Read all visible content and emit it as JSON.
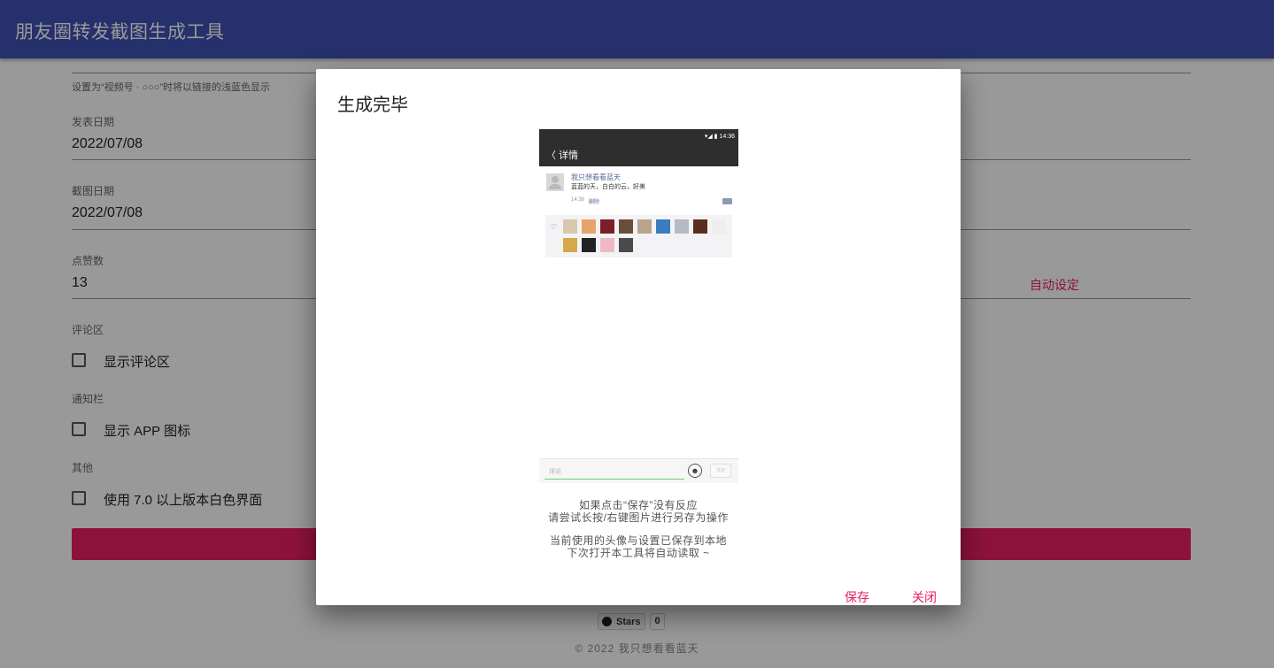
{
  "app": {
    "title": "朋友圈转发截图生成工具"
  },
  "form": {
    "hint": "设置为“视频号 · ○○○”时将以链接的浅蓝色显示",
    "publish_date": {
      "label": "发表日期",
      "value": "2022/07/08"
    },
    "screenshot_date": {
      "label": "截图日期",
      "value": "2022/07/08"
    },
    "likes": {
      "label": "点赞数",
      "value": "13",
      "auto_label": "自动设定"
    },
    "comment_section": {
      "label": "评论区",
      "checkbox": "显示评论区",
      "checked": false
    },
    "notification_bar": {
      "label": "通知栏",
      "checkbox": "显示 APP 图标",
      "checked": false
    },
    "other": {
      "label": "其他",
      "checkbox": "使用 7.0 以上版本白色界面",
      "checked": false
    }
  },
  "github": {
    "stars_label": "Stars",
    "stars_count": "0"
  },
  "footer": {
    "text": "© 2022 我只想看看蓝天"
  },
  "dialog": {
    "title": "生成完毕",
    "preview": {
      "status": "▾◢ ▮ 14:36",
      "header": "〈  详情",
      "author": "我只想看看蓝天",
      "text": "蓝蓝的天，白白的云，好美",
      "time": "14:36",
      "delete": "删除",
      "comment_placeholder": "评论",
      "send": "发送",
      "like_colors": [
        "#d9c7b0",
        "#e8a36b",
        "#7a1f2a",
        "#6a4e3a",
        "#b9a48d",
        "#3b7bbf",
        "#b5b9c7",
        "#5a2e1e",
        "#eeeeee",
        "#d4a94a",
        "#222222",
        "#f0b8c4",
        "#4a4a4a"
      ]
    },
    "note1_line1": "如果点击“保存”没有反应",
    "note1_line2": "请尝试长按/右键图片进行另存为操作",
    "note2_line1": "当前使用的头像与设置已保存到本地",
    "note2_line2": "下次打开本工具将自动读取 ~",
    "save": "保存",
    "close": "关闭"
  }
}
